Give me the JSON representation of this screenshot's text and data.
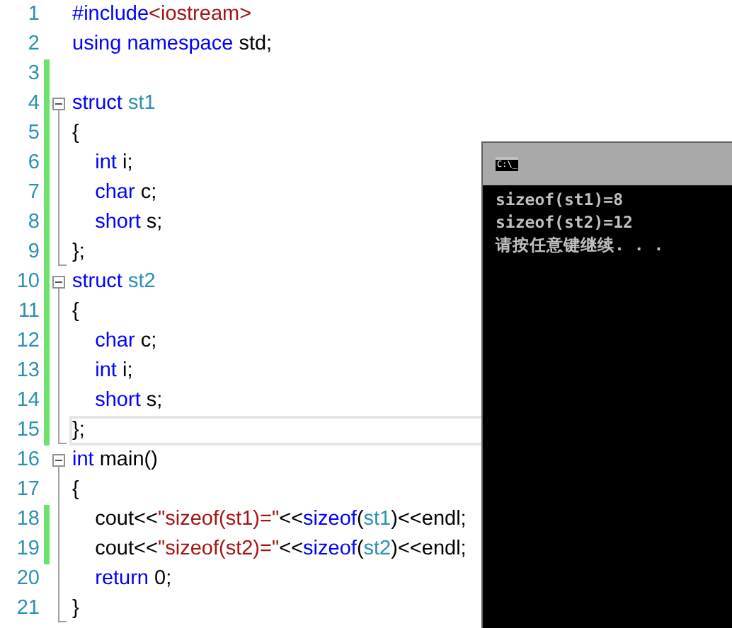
{
  "editor": {
    "lines": [
      {
        "number": "1",
        "changed": false,
        "current": false,
        "tokens": [
          {
            "kind": "keyword",
            "text": "#include"
          },
          {
            "kind": "string",
            "text": "<iostream>"
          }
        ]
      },
      {
        "number": "2",
        "changed": false,
        "current": false,
        "tokens": [
          {
            "kind": "keyword",
            "text": "using namespace"
          },
          {
            "kind": "plain",
            "text": " std;"
          }
        ]
      },
      {
        "number": "3",
        "changed": true,
        "current": false
      },
      {
        "number": "4",
        "changed": true,
        "current": false,
        "kind": "block-start",
        "tokens": [
          {
            "kind": "keyword",
            "text": "struct"
          },
          {
            "kind": "type",
            "text": " st1"
          }
        ]
      },
      {
        "number": "5",
        "changed": true,
        "current": false,
        "kind": "block-body",
        "tokens": [
          {
            "kind": "plain",
            "text": "{"
          }
        ]
      },
      {
        "number": "6",
        "changed": true,
        "current": false,
        "kind": "block-body",
        "tokens": [
          {
            "kind": "keyword",
            "text": "    int"
          },
          {
            "kind": "plain",
            "text": " i;"
          }
        ]
      },
      {
        "number": "7",
        "changed": true,
        "current": false,
        "kind": "block-body",
        "tokens": [
          {
            "kind": "keyword",
            "text": "    char"
          },
          {
            "kind": "plain",
            "text": " c;"
          }
        ]
      },
      {
        "number": "8",
        "changed": true,
        "current": false,
        "kind": "block-body",
        "tokens": [
          {
            "kind": "keyword",
            "text": "    short"
          },
          {
            "kind": "plain",
            "text": " s;"
          }
        ]
      },
      {
        "number": "9",
        "changed": true,
        "current": false,
        "kind": "block-end",
        "tokens": [
          {
            "kind": "plain",
            "text": "};"
          }
        ]
      },
      {
        "number": "10",
        "changed": true,
        "current": false,
        "kind": "block-start",
        "tokens": [
          {
            "kind": "keyword",
            "text": "struct"
          },
          {
            "kind": "type",
            "text": " st2"
          }
        ]
      },
      {
        "number": "11",
        "changed": true,
        "current": false,
        "kind": "block-body",
        "tokens": [
          {
            "kind": "plain",
            "text": "{"
          }
        ]
      },
      {
        "number": "12",
        "changed": true,
        "current": false,
        "kind": "block-body",
        "tokens": [
          {
            "kind": "keyword",
            "text": "    char"
          },
          {
            "kind": "plain",
            "text": " c;"
          }
        ]
      },
      {
        "number": "13",
        "changed": true,
        "current": false,
        "kind": "block-body",
        "tokens": [
          {
            "kind": "keyword",
            "text": "    int"
          },
          {
            "kind": "plain",
            "text": " i;"
          }
        ]
      },
      {
        "number": "14",
        "changed": true,
        "current": false,
        "kind": "block-body",
        "tokens": [
          {
            "kind": "keyword",
            "text": "    short"
          },
          {
            "kind": "plain",
            "text": " s;"
          }
        ]
      },
      {
        "number": "15",
        "changed": true,
        "current": true,
        "kind": "block-end",
        "tokens": [
          {
            "kind": "plain",
            "text": "};"
          }
        ]
      },
      {
        "number": "16",
        "changed": false,
        "current": false,
        "kind": "block-start",
        "tokens": [
          {
            "kind": "keyword",
            "text": "int"
          },
          {
            "kind": "plain",
            "text": " main()"
          }
        ]
      },
      {
        "number": "17",
        "changed": false,
        "current": false,
        "kind": "block-body",
        "tokens": [
          {
            "kind": "plain",
            "text": "{"
          }
        ]
      },
      {
        "number": "18",
        "changed": true,
        "current": false,
        "kind": "block-body",
        "tokens": [
          {
            "kind": "plain",
            "text": "    cout<<"
          },
          {
            "kind": "string",
            "text": "\"sizeof(st1)=\""
          },
          {
            "kind": "plain",
            "text": "<<"
          },
          {
            "kind": "keyword",
            "text": "sizeof"
          },
          {
            "kind": "plain",
            "text": "("
          },
          {
            "kind": "type",
            "text": "st1"
          },
          {
            "kind": "plain",
            "text": ")<<endl;"
          }
        ]
      },
      {
        "number": "19",
        "changed": true,
        "current": false,
        "kind": "block-body",
        "tokens": [
          {
            "kind": "plain",
            "text": "    cout<<"
          },
          {
            "kind": "string",
            "text": "\"sizeof(st2)=\""
          },
          {
            "kind": "plain",
            "text": "<<"
          },
          {
            "kind": "keyword",
            "text": "sizeof"
          },
          {
            "kind": "plain",
            "text": "("
          },
          {
            "kind": "type",
            "text": "st2"
          },
          {
            "kind": "plain",
            "text": ")<<endl;"
          }
        ]
      },
      {
        "number": "20",
        "changed": false,
        "current": false,
        "kind": "block-body",
        "tokens": [
          {
            "kind": "keyword",
            "text": "    return"
          },
          {
            "kind": "plain",
            "text": " 0;"
          }
        ]
      },
      {
        "number": "21",
        "changed": false,
        "current": false,
        "kind": "block-end",
        "tokens": [
          {
            "kind": "plain",
            "text": "}"
          }
        ]
      }
    ]
  },
  "console": {
    "icon_label": "C:\\_",
    "lines": [
      "sizeof(st1)=8",
      "sizeof(st2)=12",
      "请按任意键继续. . ."
    ]
  }
}
